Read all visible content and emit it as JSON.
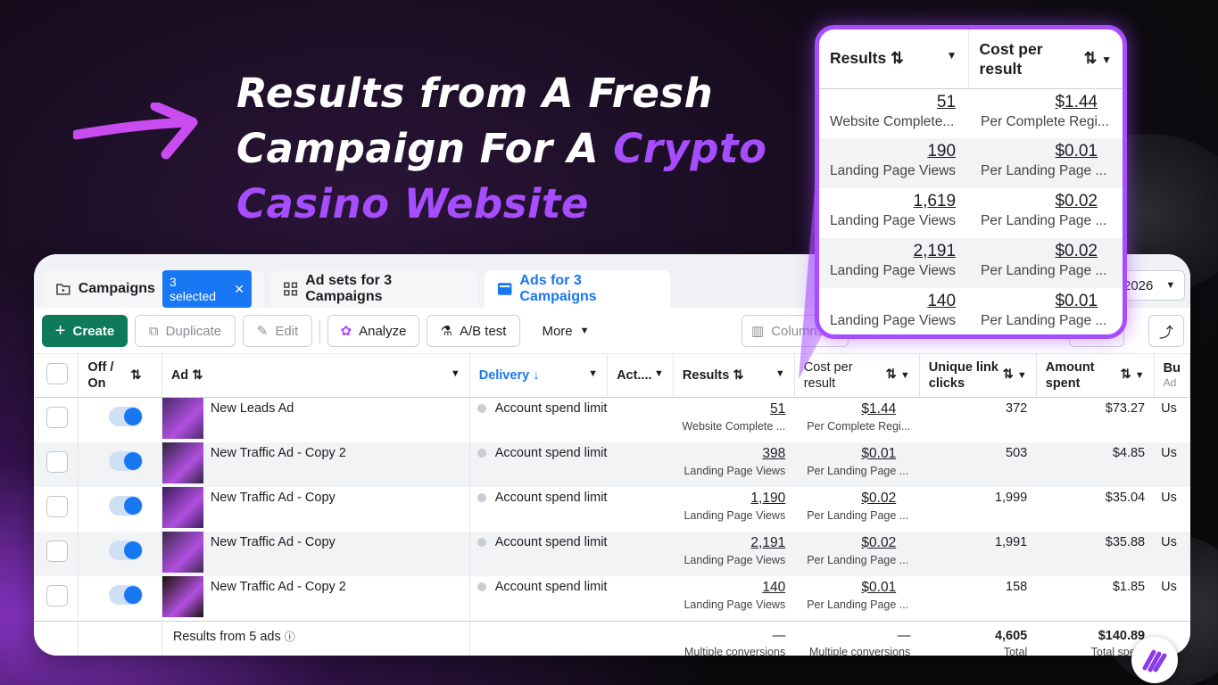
{
  "headline": {
    "line1": "Results from A Fresh",
    "line2a": "Campaign For A ",
    "line2b": "Crypto",
    "line3": "Casino Website"
  },
  "tabs": {
    "campaigns": "Campaigns",
    "selected": "3 selected",
    "adsets": "Ad sets for 3 Campaigns",
    "ads": "Ads for 3 Campaigns",
    "date_frag": "2026"
  },
  "toolbar": {
    "create": "Create",
    "duplicate": "Duplicate",
    "edit": "Edit",
    "analyze": "Analyze",
    "abtest": "A/B test",
    "more": "More",
    "columns": "Columns"
  },
  "headers": {
    "offon": "Off / On",
    "ad": "Ad",
    "delivery": "Delivery",
    "actions": "Act....",
    "results": "Results",
    "cost": "Cost per result",
    "unique": "Unique link clicks",
    "amount": "Amount spent",
    "bu": "Bu",
    "ad_frag": "Ad"
  },
  "rows": [
    {
      "name": "New Leads Ad",
      "delivery": "Account spend limit",
      "results": "51",
      "results_sub": "Website Complete ...",
      "cost": "$1.44",
      "cost_sub": "Per Complete Regi...",
      "unique": "372",
      "amount": "$73.27",
      "bu": "Us"
    },
    {
      "name": "New Traffic Ad - Copy 2",
      "delivery": "Account spend limit",
      "results": "398",
      "results_sub": "Landing Page Views",
      "cost": "$0.01",
      "cost_sub": "Per Landing Page ...",
      "unique": "503",
      "amount": "$4.85",
      "bu": "Us"
    },
    {
      "name": "New Traffic Ad - Copy",
      "delivery": "Account spend limit",
      "results": "1,190",
      "results_sub": "Landing Page Views",
      "cost": "$0.02",
      "cost_sub": "Per Landing Page ...",
      "unique": "1,999",
      "amount": "$35.04",
      "bu": "Us"
    },
    {
      "name": "New Traffic Ad - Copy",
      "delivery": "Account spend limit",
      "results": "2,191",
      "results_sub": "Landing Page Views",
      "cost": "$0.02",
      "cost_sub": "Per Landing Page ...",
      "unique": "1,991",
      "amount": "$35.88",
      "bu": "Us"
    },
    {
      "name": "New Traffic Ad - Copy 2",
      "delivery": "Account spend limit",
      "results": "140",
      "results_sub": "Landing Page Views",
      "cost": "$0.01",
      "cost_sub": "Per Landing Page ...",
      "unique": "158",
      "amount": "$1.85",
      "bu": "Us"
    }
  ],
  "footer": {
    "label": "Results from 5 ads",
    "results": "—",
    "results_sub": "Multiple conversions",
    "cost": "—",
    "cost_sub": "Multiple conversions",
    "unique": "4,605",
    "unique_sub": "Total",
    "amount": "$140.89",
    "amount_sub": "Total spent"
  },
  "callout": {
    "h_results": "Results",
    "h_cost": "Cost per result",
    "rows": [
      {
        "results": "51",
        "results_sub": "Website Complete...",
        "cost": "$1.44",
        "cost_sub": "Per Complete Regi..."
      },
      {
        "results": "190",
        "results_sub": "Landing Page Views",
        "cost": "$0.01",
        "cost_sub": "Per Landing Page ..."
      },
      {
        "results": "1,619",
        "results_sub": "Landing Page Views",
        "cost": "$0.02",
        "cost_sub": "Per Landing Page ..."
      },
      {
        "results": "2,191",
        "results_sub": "Landing Page Views",
        "cost": "$0.02",
        "cost_sub": "Per Landing Page ..."
      },
      {
        "results": "140",
        "results_sub": "Landing Page Views",
        "cost": "$0.01",
        "cost_sub": "Per Landing Page ..."
      }
    ]
  },
  "colors": {
    "accent": "#a64dff",
    "primary": "#0e7a5a",
    "link": "#1877f2"
  }
}
